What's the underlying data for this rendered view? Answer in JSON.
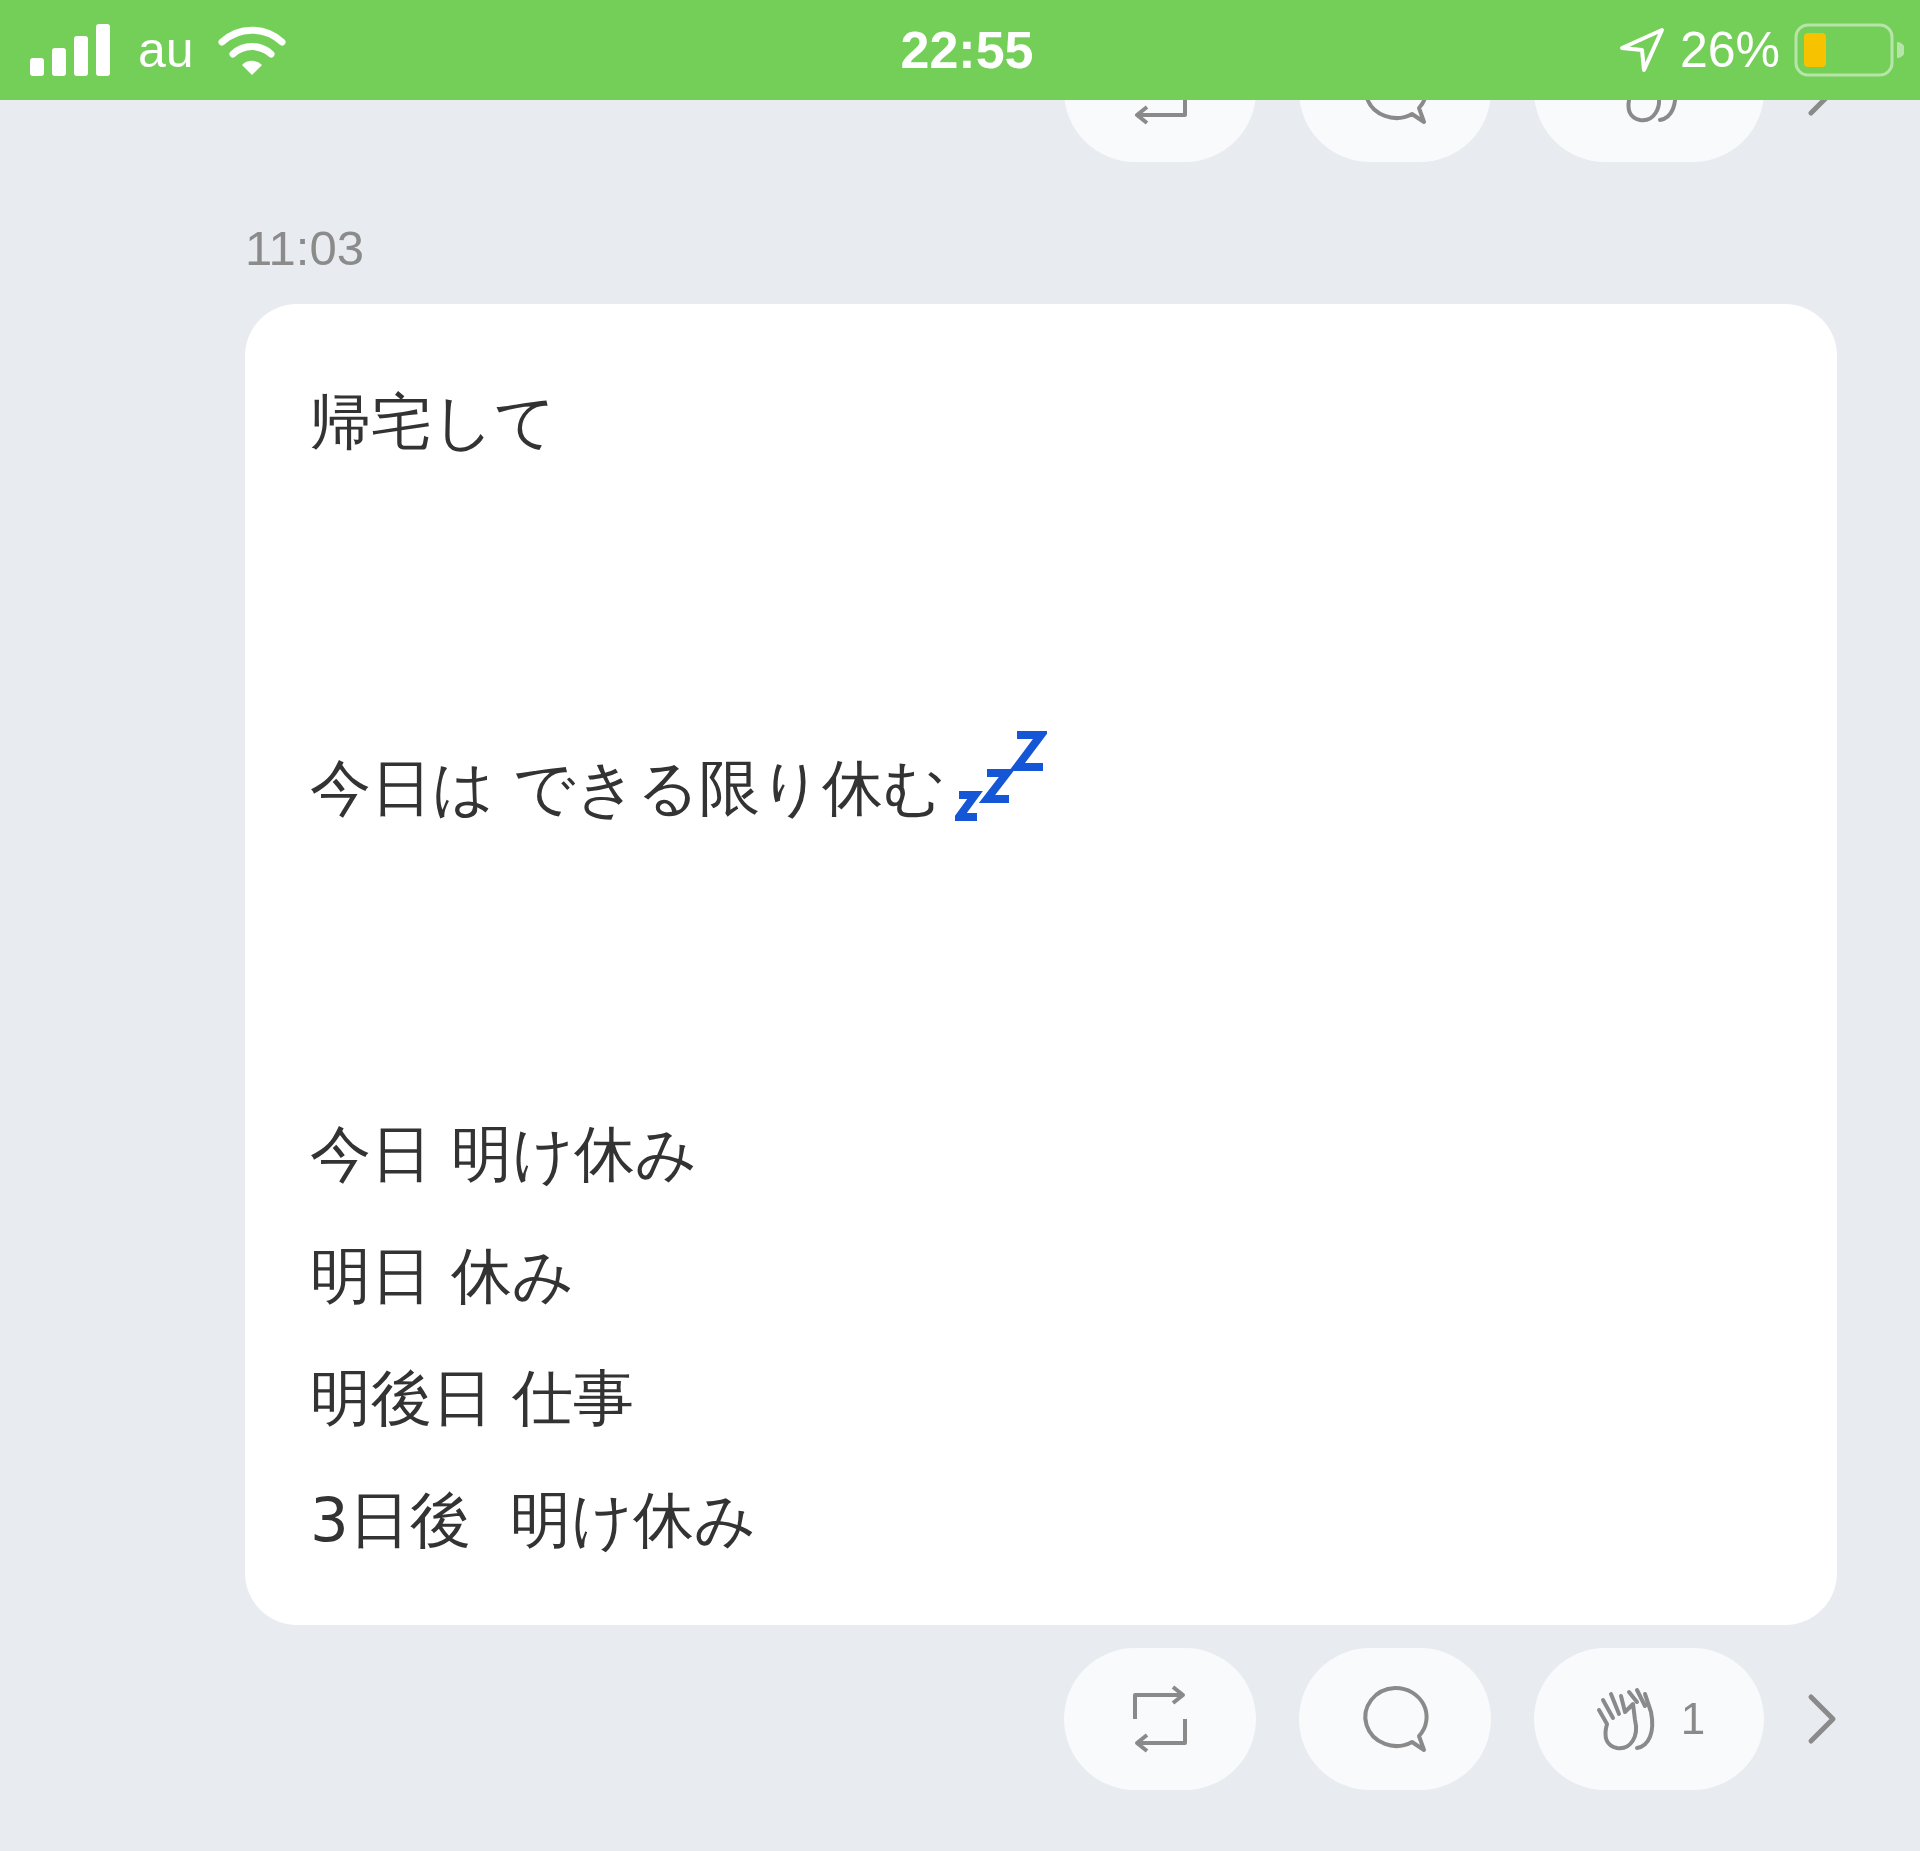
{
  "status_bar": {
    "carrier": "au",
    "time": "22:55",
    "battery": "26%"
  },
  "post": {
    "time": "11:03",
    "paragraphs": [
      {
        "lines": [
          "帰宅して"
        ]
      },
      {
        "lines": [
          "今日は できる限り休む"
        ],
        "kind": "with_sleep_icon"
      },
      {
        "lines": [
          "今日 明け休み",
          "明日 休み",
          "明後日 仕事",
          "3日後  明け休み"
        ]
      }
    ]
  },
  "actions": {
    "clap_count": "1"
  }
}
